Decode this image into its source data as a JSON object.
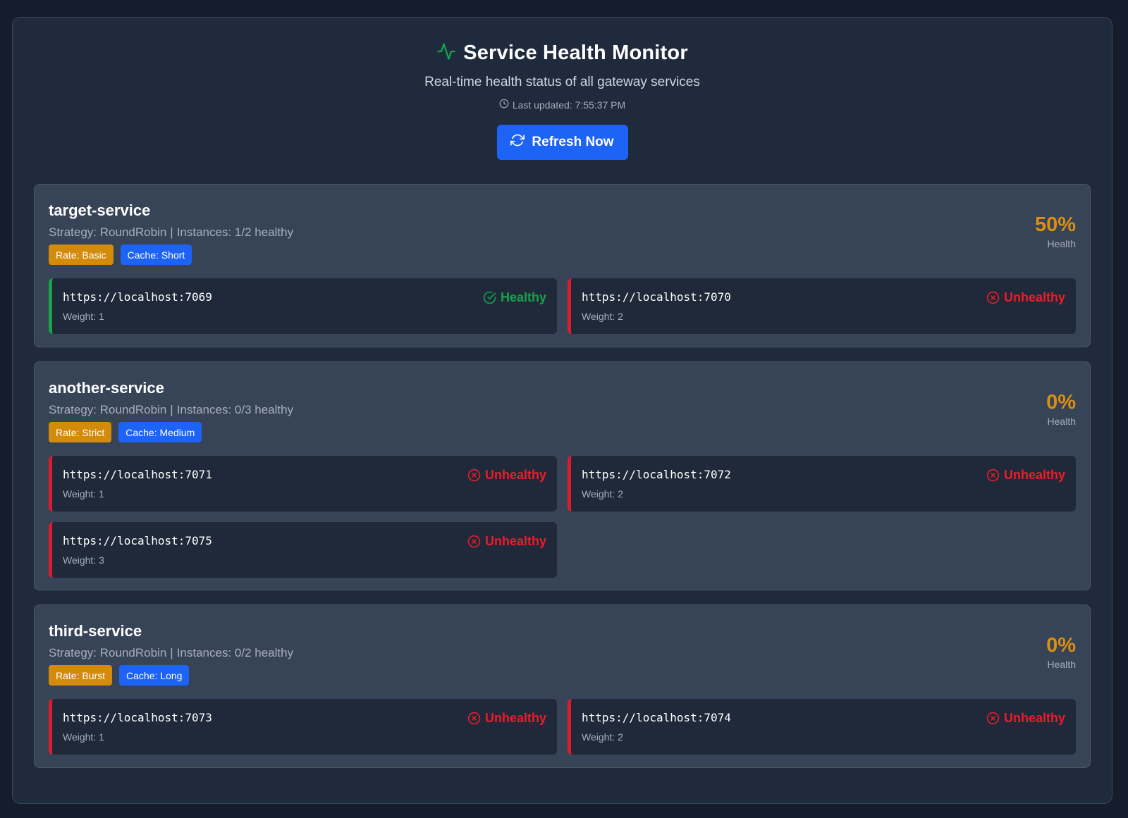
{
  "header": {
    "title": "Service Health Monitor",
    "subtitle": "Real-time health status of all gateway services",
    "last_updated": "Last updated: 7:55:37 PM",
    "refresh_label": "Refresh Now",
    "icons": {
      "title": "activity-icon",
      "updated": "clock-icon",
      "refresh": "refresh-icon"
    }
  },
  "colors": {
    "accent": "#1d63f5",
    "healthy": "#16a34a",
    "unhealthy": "#ee1b2a",
    "warning": "#d98f12"
  },
  "health_label": "Health",
  "services": [
    {
      "name": "target-service",
      "strategy": "Strategy: RoundRobin",
      "instances_summary": "Instances: 1/2 healthy",
      "rate": "Rate: Basic",
      "cache": "Cache: Short",
      "health_pct": "50%",
      "instances": [
        {
          "url": "https://localhost:7069",
          "weight": "Weight: 1",
          "status": "Healthy",
          "healthy": true
        },
        {
          "url": "https://localhost:7070",
          "weight": "Weight: 2",
          "status": "Unhealthy",
          "healthy": false
        }
      ]
    },
    {
      "name": "another-service",
      "strategy": "Strategy: RoundRobin",
      "instances_summary": "Instances: 0/3 healthy",
      "rate": "Rate: Strict",
      "cache": "Cache: Medium",
      "health_pct": "0%",
      "instances": [
        {
          "url": "https://localhost:7071",
          "weight": "Weight: 1",
          "status": "Unhealthy",
          "healthy": false
        },
        {
          "url": "https://localhost:7072",
          "weight": "Weight: 2",
          "status": "Unhealthy",
          "healthy": false
        },
        {
          "url": "https://localhost:7075",
          "weight": "Weight: 3",
          "status": "Unhealthy",
          "healthy": false
        }
      ]
    },
    {
      "name": "third-service",
      "strategy": "Strategy: RoundRobin",
      "instances_summary": "Instances: 0/2 healthy",
      "rate": "Rate: Burst",
      "cache": "Cache: Long",
      "health_pct": "0%",
      "instances": [
        {
          "url": "https://localhost:7073",
          "weight": "Weight: 1",
          "status": "Unhealthy",
          "healthy": false
        },
        {
          "url": "https://localhost:7074",
          "weight": "Weight: 2",
          "status": "Unhealthy",
          "healthy": false
        }
      ]
    }
  ]
}
